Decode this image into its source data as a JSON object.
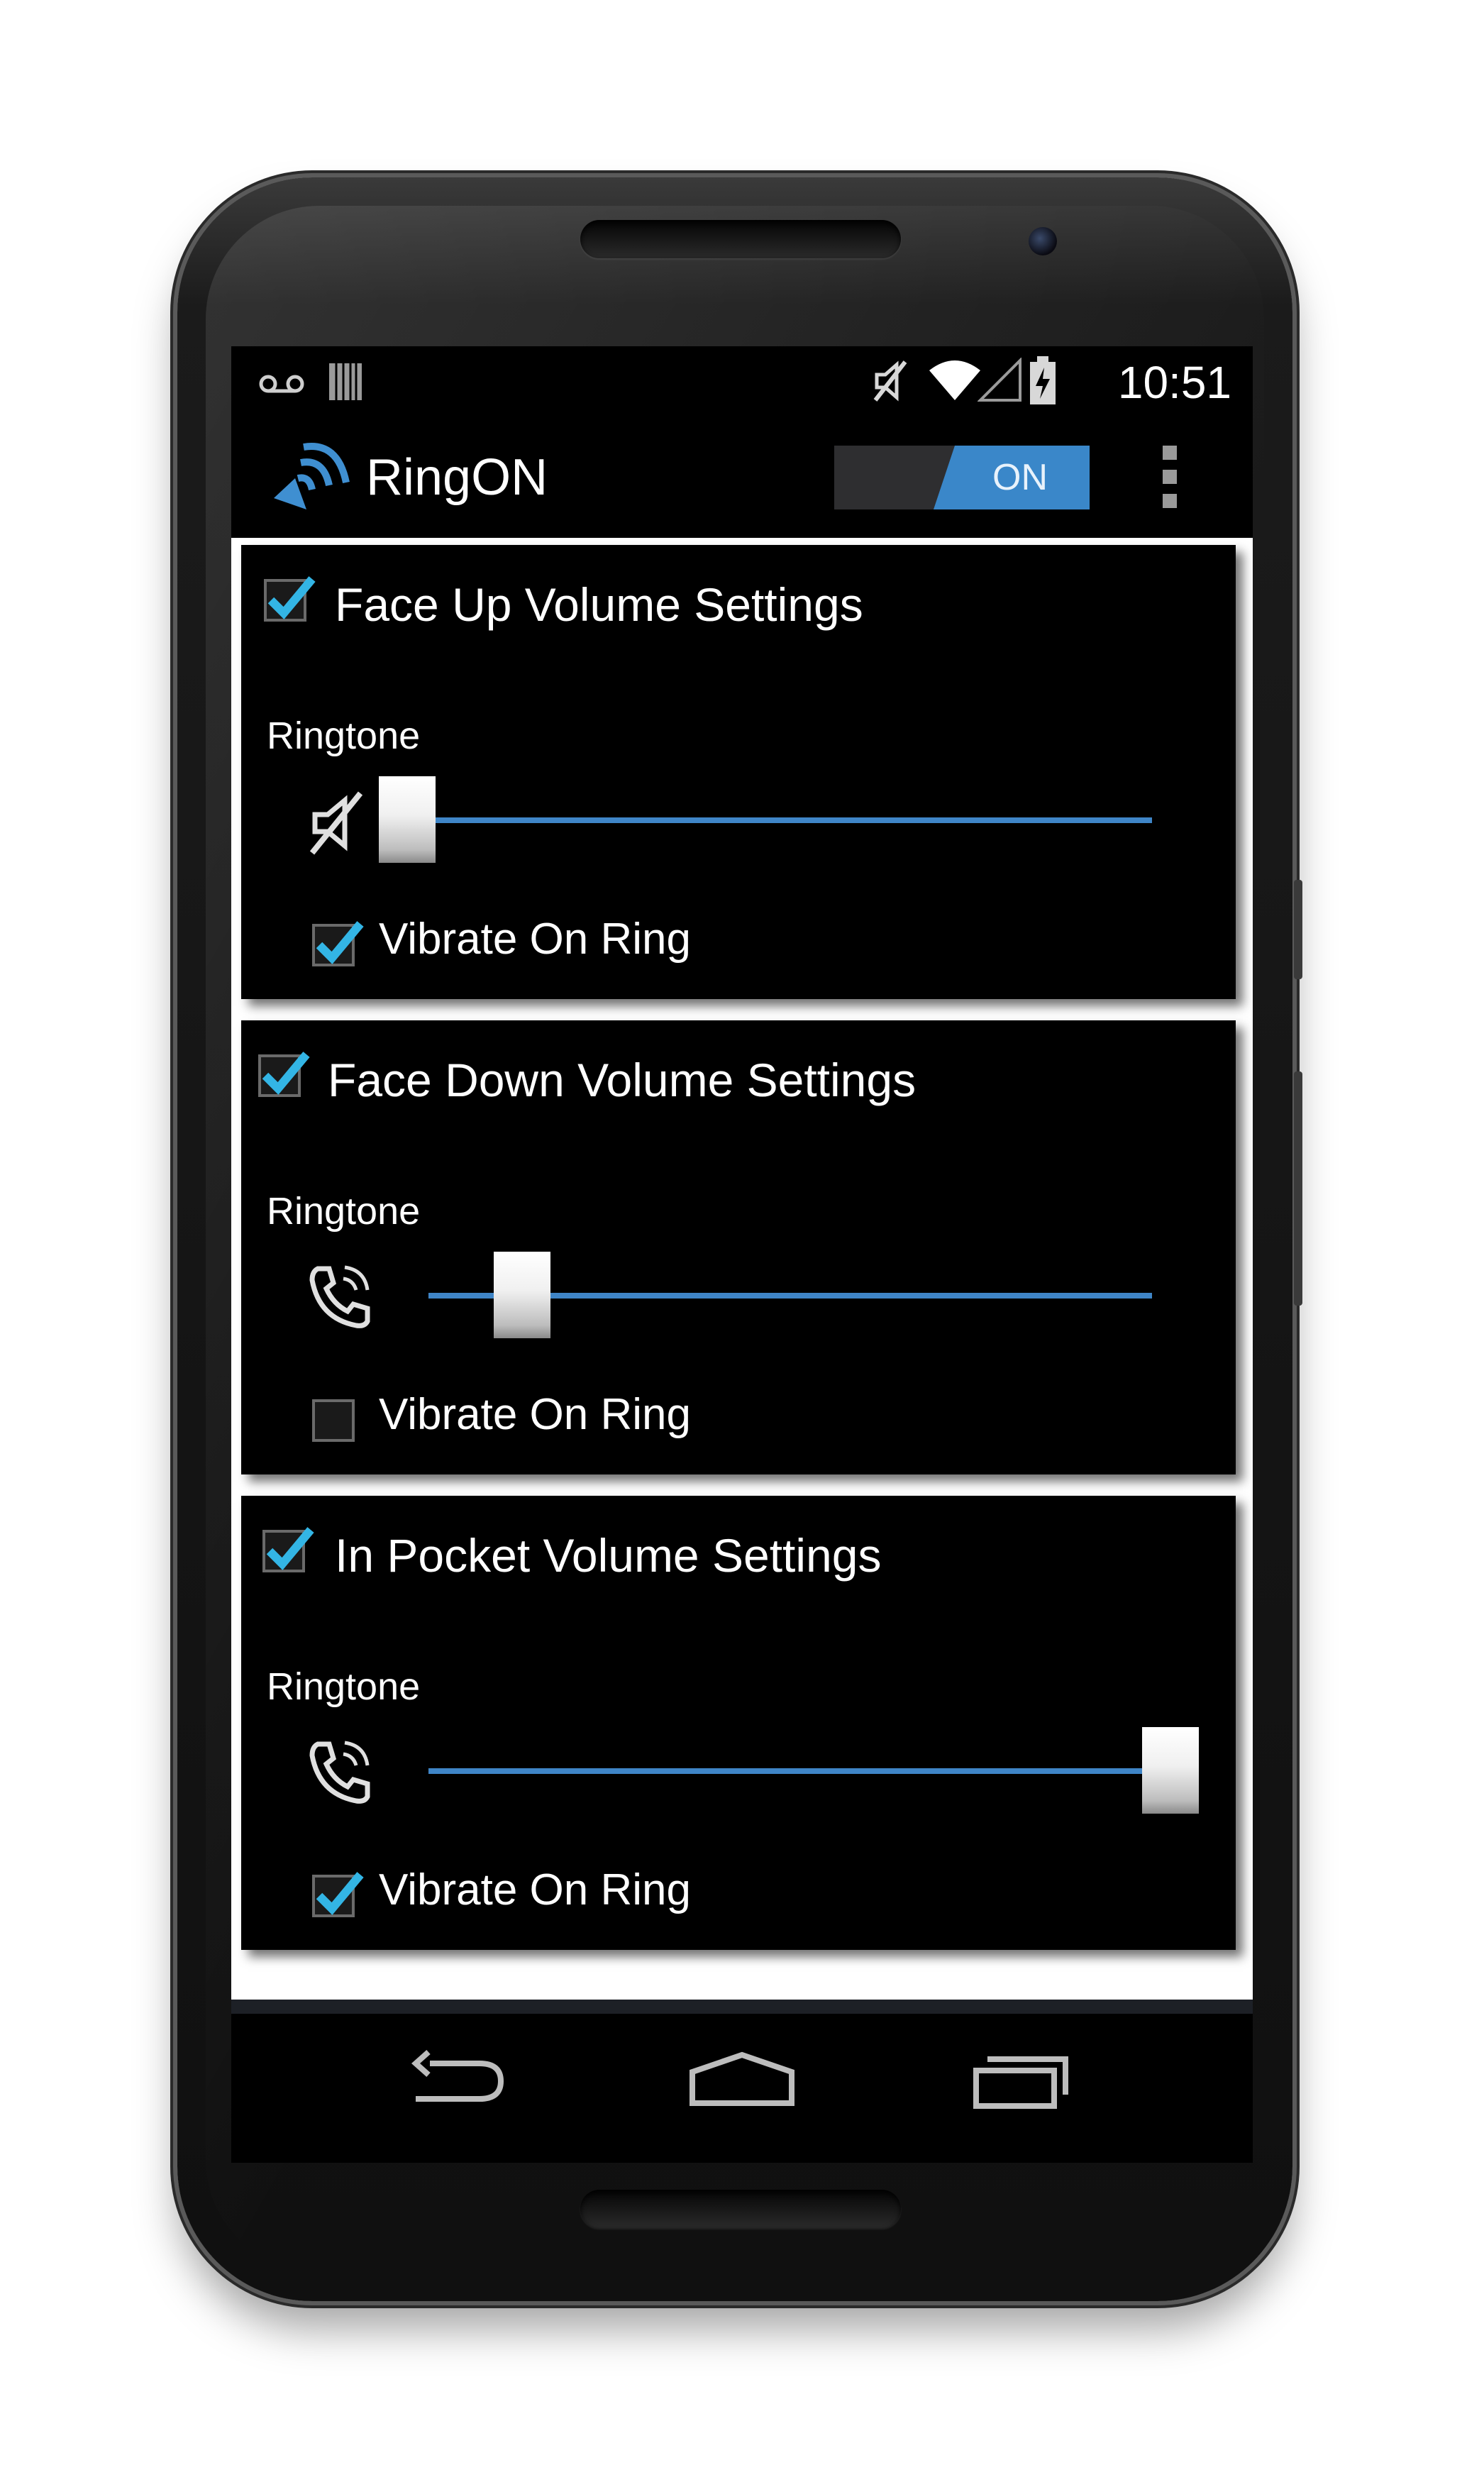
{
  "status_bar": {
    "time": "10:51",
    "left_icons": [
      "voicemail-icon",
      "sim-card-icon"
    ],
    "right_icons": [
      "mute-icon",
      "wifi-icon",
      "signal-icon",
      "battery-charging-icon"
    ]
  },
  "action_bar": {
    "app_icon": "speaker-waves-icon",
    "title": "RingON",
    "toggle_label": "ON",
    "toggle_state": "on",
    "overflow_icon": "more-vert-icon"
  },
  "cards": [
    {
      "title": "Face Up Volume Settings",
      "enabled": true,
      "ringtone_label": "Ringtone",
      "ringtone_icon": "muted-speaker-icon",
      "ringtone_level": 0.0,
      "vibrate_label": "Vibrate On Ring",
      "vibrate": true
    },
    {
      "title": "Face Down Volume Settings",
      "enabled": true,
      "ringtone_label": "Ringtone",
      "ringtone_icon": "ringing-phone-icon",
      "ringtone_level": 0.12,
      "vibrate_label": "Vibrate On Ring",
      "vibrate": false
    },
    {
      "title": "In Pocket Volume Settings",
      "enabled": true,
      "ringtone_label": "Ringtone",
      "ringtone_icon": "ringing-phone-icon",
      "ringtone_level": 1.0,
      "vibrate_label": "Vibrate On Ring",
      "vibrate": true
    }
  ],
  "nav_bar": {
    "buttons": [
      "back-icon",
      "home-icon",
      "recents-icon"
    ]
  },
  "colors": {
    "accent": "#3a87c9",
    "check": "#33b5e5",
    "background": "#000000"
  }
}
